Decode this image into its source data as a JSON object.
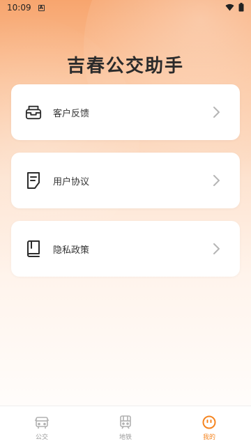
{
  "status": {
    "time": "10:09",
    "notif_glyph": "A"
  },
  "app_title": "吉春公交助手",
  "menu": [
    {
      "label": "客户反馈",
      "icon": "inbox-icon"
    },
    {
      "label": "用户协议",
      "icon": "document-icon"
    },
    {
      "label": "隐私政策",
      "icon": "book-icon"
    }
  ],
  "tabs": [
    {
      "label": "公交",
      "icon": "bus-icon",
      "active": false
    },
    {
      "label": "地铁",
      "icon": "subway-icon",
      "active": false
    },
    {
      "label": "我的",
      "icon": "smiley-icon",
      "active": true
    }
  ],
  "colors": {
    "accent": "#f5841f",
    "inactive": "#9a9a9a",
    "text": "#333333"
  }
}
